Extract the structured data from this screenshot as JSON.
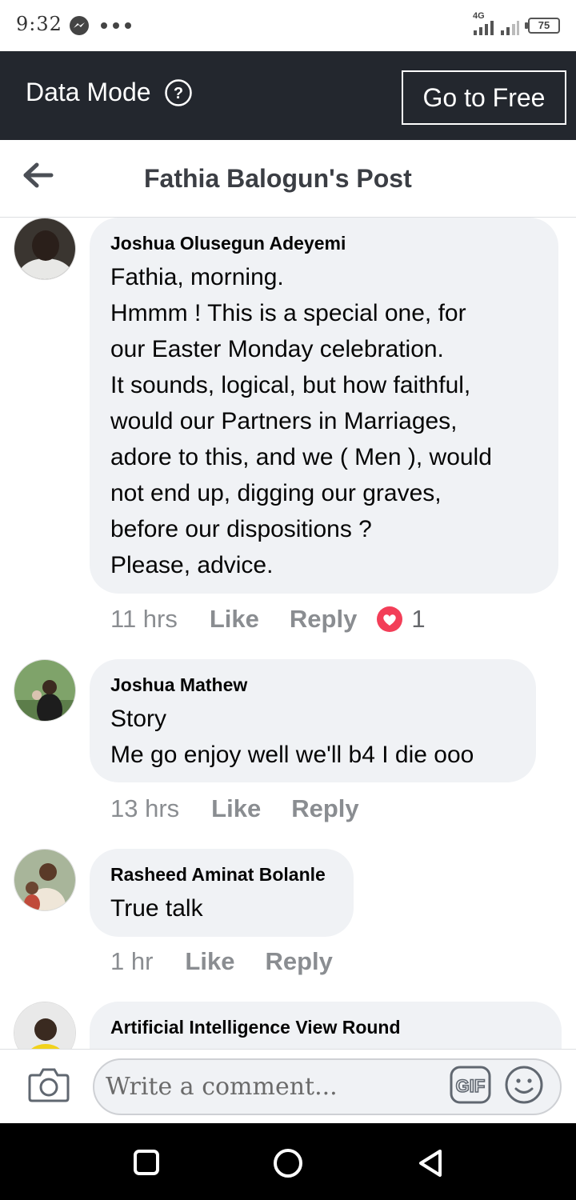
{
  "status_bar": {
    "time": "9:32",
    "network": "4G",
    "battery": "75",
    "icons": [
      "messenger-icon",
      "more-dots-icon",
      "signal-icon",
      "signal-icon"
    ]
  },
  "data_bar": {
    "label": "Data Mode",
    "help_icon": "question-circle-icon",
    "button": "Go to Free"
  },
  "header": {
    "back_icon": "arrow-left-icon",
    "title": "Fathia Balogun's Post"
  },
  "comments": [
    {
      "author": "Joshua Olusegun Adeyemi",
      "text": "Fathia, morning.\nHmmm ! This is a special one, for\nour Easter Monday celebration.\nIt sounds, logical, but how faithful,\nwould our Partners in Marriages,\nadore to this, and we ( Men ), would\nnot end up, digging our graves,\nbefore our dispositions ?\nPlease, advice.",
      "time": "11 hrs",
      "like": "Like",
      "reply": "Reply",
      "reactions": "1"
    },
    {
      "author": "Joshua Mathew",
      "text": "Story\nMe go enjoy well we'll b4 I die ooo",
      "time": "13 hrs",
      "like": "Like",
      "reply": "Reply"
    },
    {
      "author": "Rasheed Aminat Bolanle",
      "text": "True talk",
      "time": "1 hr",
      "like": "Like",
      "reply": "Reply"
    },
    {
      "author": "Artificial Intelligence View Round"
    }
  ],
  "composer": {
    "placeholder": "Write a comment...",
    "icons": [
      "camera-icon",
      "gif-icon",
      "emoji-icon"
    ]
  },
  "colors": {
    "data_bar_bg": "#23272e",
    "bubble_bg": "#f0f2f5",
    "meta_text": "#8a8d91",
    "reaction_heart": "#f33e58"
  }
}
